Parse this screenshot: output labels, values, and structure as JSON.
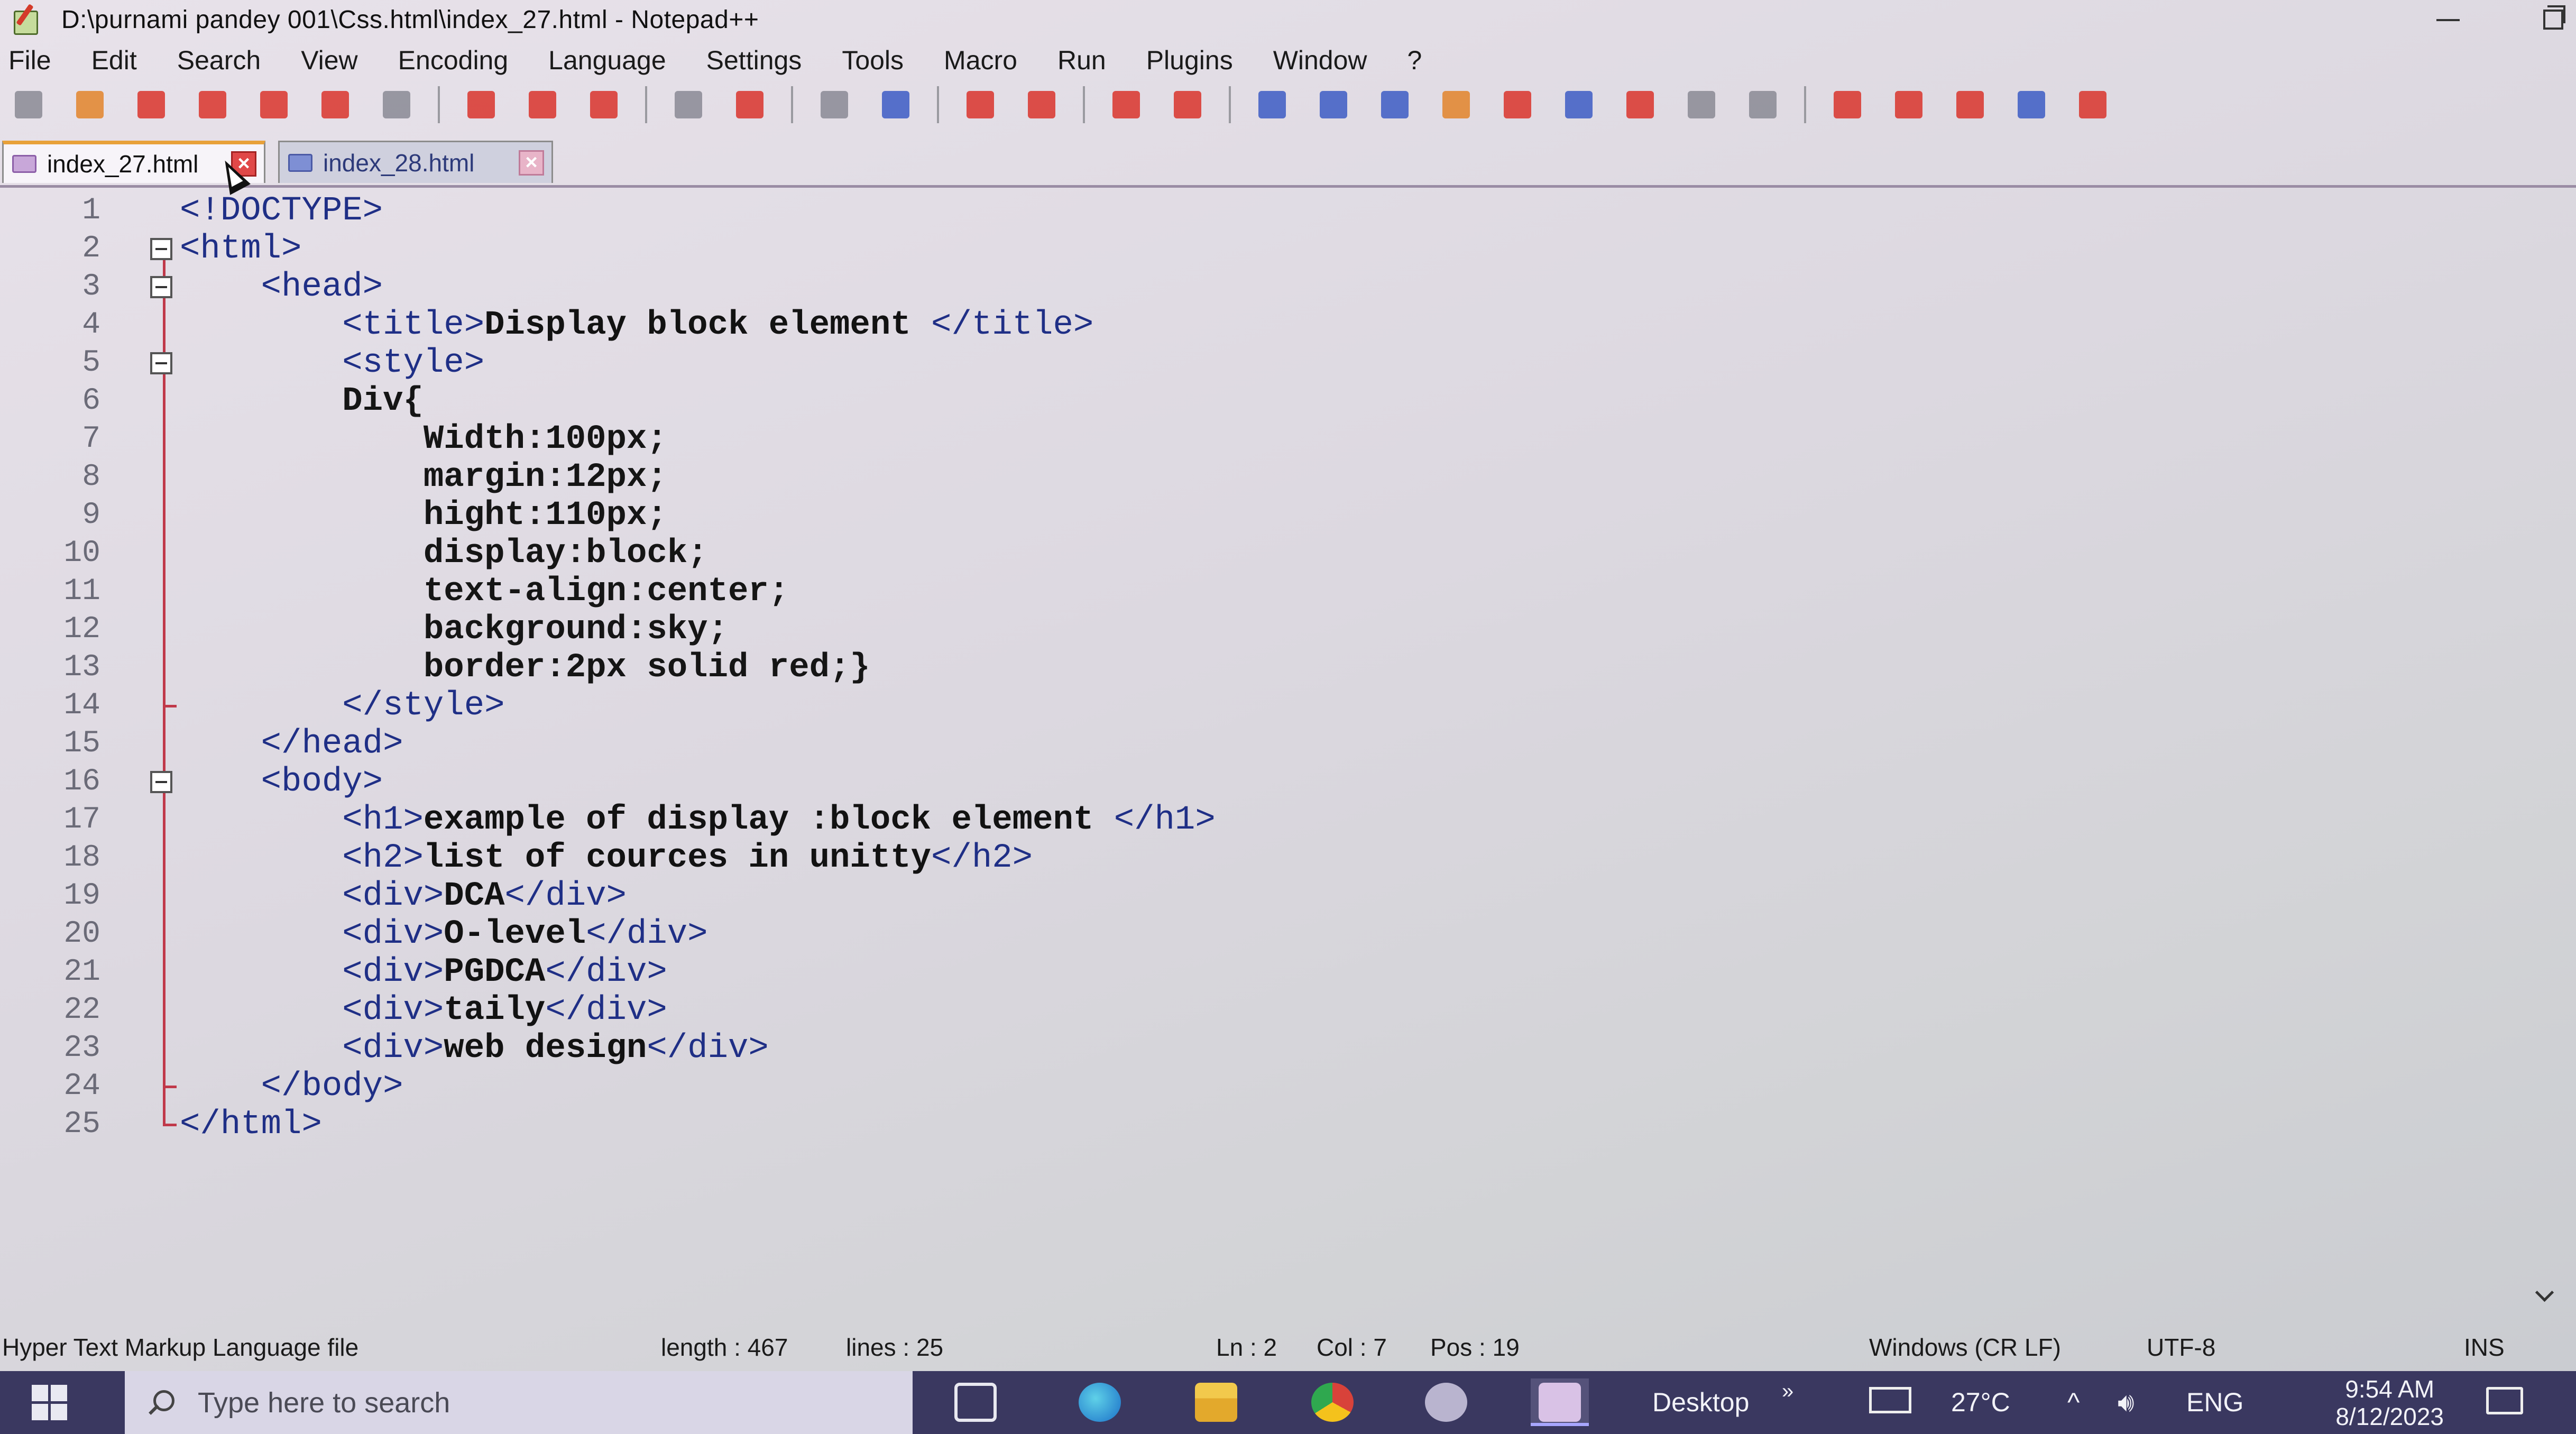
{
  "window": {
    "title": "D:\\purnami pandey 001\\Css.html\\index_27.html - Notepad++"
  },
  "menu": [
    "File",
    "Edit",
    "Search",
    "View",
    "Encoding",
    "Language",
    "Settings",
    "Tools",
    "Macro",
    "Run",
    "Plugins",
    "Window",
    "?"
  ],
  "toolbar_icons": [
    "new-file-icon",
    "open-file-icon",
    "save-icon",
    "save-all-icon",
    "close-icon",
    "close-all-icon",
    "print-icon",
    "cut-icon",
    "copy-icon",
    "paste-icon",
    "undo-icon",
    "redo-icon",
    "find-icon",
    "replace-icon",
    "zoom-in-icon",
    "zoom-out-icon",
    "sync-vertical-icon",
    "sync-horizontal-icon",
    "word-wrap-icon",
    "show-all-chars-icon",
    "indent-guide-icon",
    "udl-icon",
    "doc-map-icon",
    "function-list-icon",
    "folder-workspace-icon",
    "monitoring-icon",
    "eye-icon",
    "record-macro-icon",
    "stop-record-icon",
    "play-macro-icon",
    "run-macro-multiple-icon",
    "save-macro-icon"
  ],
  "toolbar_colors": {
    "red": "#d9342b",
    "orange": "#e2842a",
    "blue": "#3c5cc4",
    "purple": "#9a4fb6",
    "gray": "#8a8a94",
    "green": "#4f8f3a"
  },
  "tabs": [
    {
      "label": "index_27.html",
      "active": true
    },
    {
      "label": "index_28.html",
      "active": false
    }
  ],
  "editor": {
    "line_numbers": [
      "1",
      "2",
      "3",
      "4",
      "5",
      "6",
      "7",
      "8",
      "9",
      "10",
      "11",
      "12",
      "13",
      "14",
      "15",
      "16",
      "17",
      "18",
      "19",
      "20",
      "21",
      "22",
      "23",
      "24",
      "25"
    ],
    "lines": [
      [
        {
          "c": "tag",
          "t": "<!DOCTYPE>"
        }
      ],
      [
        {
          "c": "tag",
          "t": "<html>"
        }
      ],
      [
        {
          "c": "tag",
          "t": "    <head>"
        }
      ],
      [
        {
          "c": "tag",
          "t": "        <title>"
        },
        {
          "c": "txt",
          "t": "Display block element "
        },
        {
          "c": "tag",
          "t": "</title>"
        }
      ],
      [
        {
          "c": "tag",
          "t": "        <style>"
        }
      ],
      [
        {
          "c": "sty",
          "t": "        Div{"
        }
      ],
      [
        {
          "c": "sty",
          "t": "            Width:100px;"
        }
      ],
      [
        {
          "c": "sty",
          "t": "            margin:12px;"
        }
      ],
      [
        {
          "c": "sty",
          "t": "            hight:110px;"
        }
      ],
      [
        {
          "c": "sty",
          "t": "            display:block;"
        }
      ],
      [
        {
          "c": "sty",
          "t": "            text-align:center;"
        }
      ],
      [
        {
          "c": "sty",
          "t": "            background:sky;"
        }
      ],
      [
        {
          "c": "sty",
          "t": "            border:2px solid red;}"
        }
      ],
      [
        {
          "c": "tag",
          "t": "        </style>"
        }
      ],
      [
        {
          "c": "tag",
          "t": "    </head>"
        }
      ],
      [
        {
          "c": "tag",
          "t": "    <body>"
        }
      ],
      [
        {
          "c": "tag",
          "t": "        <h1>"
        },
        {
          "c": "txt",
          "t": "example of display :block element "
        },
        {
          "c": "tag",
          "t": "</h1>"
        }
      ],
      [
        {
          "c": "tag",
          "t": "        <h2>"
        },
        {
          "c": "txt",
          "t": "list of cources in unitty"
        },
        {
          "c": "tag",
          "t": "</h2>"
        }
      ],
      [
        {
          "c": "tag",
          "t": "        <div>"
        },
        {
          "c": "txt",
          "t": "DCA"
        },
        {
          "c": "tag",
          "t": "</div>"
        }
      ],
      [
        {
          "c": "tag",
          "t": "        <div>"
        },
        {
          "c": "txt",
          "t": "O-level"
        },
        {
          "c": "tag",
          "t": "</div>"
        }
      ],
      [
        {
          "c": "tag",
          "t": "        <div>"
        },
        {
          "c": "txt",
          "t": "PGDCA"
        },
        {
          "c": "tag",
          "t": "</div>"
        }
      ],
      [
        {
          "c": "tag",
          "t": "        <div>"
        },
        {
          "c": "txt",
          "t": "taily"
        },
        {
          "c": "tag",
          "t": "</div>"
        }
      ],
      [
        {
          "c": "tag",
          "t": "        <div>"
        },
        {
          "c": "txt",
          "t": "web design"
        },
        {
          "c": "tag",
          "t": "</div>"
        }
      ],
      [
        {
          "c": "tag",
          "t": "    </body>"
        }
      ],
      [
        {
          "c": "tag",
          "t": "</html>"
        }
      ]
    ]
  },
  "status": {
    "file_type": "Hyper Text Markup Language file",
    "length": "length : 467",
    "lines": "lines : 25",
    "ln": "Ln : 2",
    "col": "Col : 7",
    "pos": "Pos : 19",
    "eol": "Windows (CR LF)",
    "encoding": "UTF-8",
    "mode": "INS"
  },
  "taskbar": {
    "search_placeholder": "Type here to search",
    "desktop_label": "Desktop",
    "desktop_chevron": "»",
    "temperature": "27°C",
    "language": "ENG",
    "time": "9:54 AM",
    "date": "8/12/2023"
  }
}
